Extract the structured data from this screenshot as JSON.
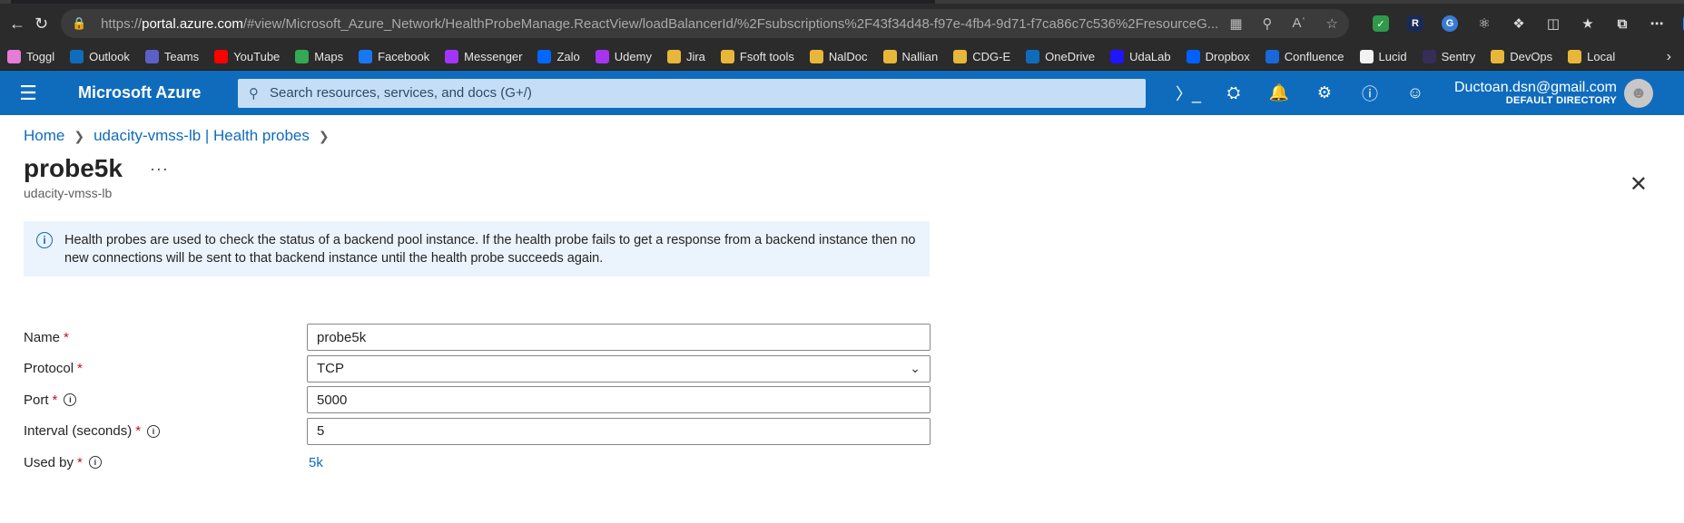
{
  "browser": {
    "url_prefix": "https://",
    "url_host": "portal.azure.com",
    "url_rest": "/#view/Microsoft_Azure_Network/HealthProbeManage.ReactView/loadBalancerId/%2Fsubscriptions%2F43f34d48-f97e-4fb4-9d71-f7ca86c7c536%2FresourceG..."
  },
  "bookmarks": [
    {
      "label": "Toggl",
      "color": "#e57cd8"
    },
    {
      "label": "Outlook",
      "color": "#0f6cbd"
    },
    {
      "label": "Teams",
      "color": "#5b5fc7"
    },
    {
      "label": "YouTube",
      "color": "#ff0000"
    },
    {
      "label": "Maps",
      "color": "#34a853"
    },
    {
      "label": "Facebook",
      "color": "#1877f2"
    },
    {
      "label": "Messenger",
      "color": "#a334fa"
    },
    {
      "label": "Zalo",
      "color": "#0068ff"
    },
    {
      "label": "Udemy",
      "color": "#a435f0"
    },
    {
      "label": "Jira",
      "color": "#e8b73a"
    },
    {
      "label": "Fsoft tools",
      "color": "#e8b73a"
    },
    {
      "label": "NalDoc",
      "color": "#e8b73a"
    },
    {
      "label": "Nallian",
      "color": "#e8b73a"
    },
    {
      "label": "CDG-E",
      "color": "#e8b73a"
    },
    {
      "label": "OneDrive",
      "color": "#0f6cbd"
    },
    {
      "label": "UdaLab",
      "color": "#2015ff"
    },
    {
      "label": "Dropbox",
      "color": "#0061fe"
    },
    {
      "label": "Confluence",
      "color": "#1868db"
    },
    {
      "label": "Lucid",
      "color": "#f2f2f2"
    },
    {
      "label": "Sentry",
      "color": "#362d59"
    },
    {
      "label": "DevOps",
      "color": "#e8b73a"
    },
    {
      "label": "Local",
      "color": "#e8b73a"
    }
  ],
  "azure": {
    "brand": "Microsoft Azure",
    "search_placeholder": "Search resources, services, and docs (G+/)",
    "account_email": "Ductoan.dsn@gmail.com",
    "account_directory": "DEFAULT DIRECTORY",
    "accent": "#0f6cbd"
  },
  "breadcrumb": {
    "home": "Home",
    "parent": "udacity-vmss-lb | Health probes"
  },
  "page": {
    "title": "probe5k",
    "more": "···",
    "subtitle": "udacity-vmss-lb",
    "close": "✕"
  },
  "info": {
    "text": "Health probes are used to check the status of a backend pool instance. If the health probe fails to get a response from a backend instance then no new connections will be sent to that backend instance until the health probe succeeds again."
  },
  "form": {
    "name_label": "Name",
    "name_value": "probe5k",
    "protocol_label": "Protocol",
    "protocol_value": "TCP",
    "port_label": "Port",
    "port_value": "5000",
    "interval_label": "Interval (seconds)",
    "interval_value": "5",
    "usedby_label": "Used by",
    "usedby_value": "5k",
    "required_mark": "*"
  }
}
